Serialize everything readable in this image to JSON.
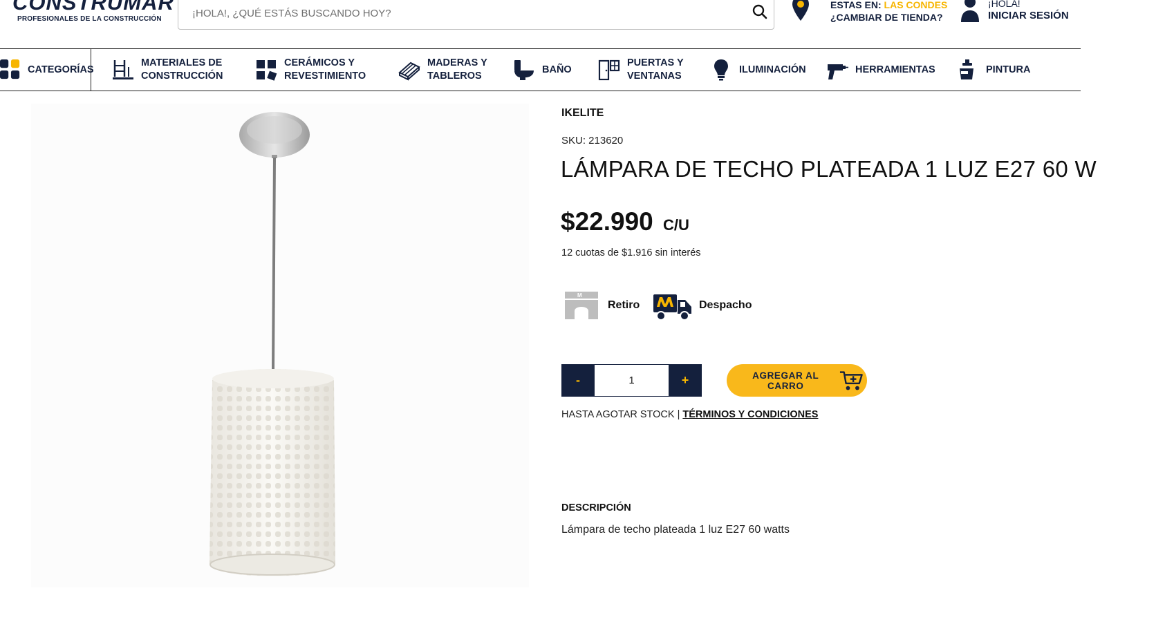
{
  "header": {
    "logo_text_1": "CONSTRU",
    "logo_text_2": "MART",
    "logo_tagline": "PROFESIONALES DE LA CONSTRUCCIÓN",
    "search_placeholder": "¡HOLA!, ¿QUÉ ESTÁS BUSCANDO HOY?",
    "store_prefix": "ESTAS EN:",
    "store_name": "LAS CONDES",
    "store_change": "¿CAMBIAR DE TIENDA?",
    "user_greeting": "¡HOLA!",
    "user_login": "INICIAR SESIÓN"
  },
  "nav": {
    "categories": "CATEGORÍAS",
    "items": [
      {
        "line1": "MATERIALES DE",
        "line2": "CONSTRUCCIÓN"
      },
      {
        "line1": "CERÁMICOS Y",
        "line2": "REVESTIMIENTO"
      },
      {
        "line1": "MADERAS Y",
        "line2": "TABLEROS"
      },
      {
        "line1": "BAÑO",
        "line2": ""
      },
      {
        "line1": "PUERTAS Y",
        "line2": "VENTANAS"
      },
      {
        "line1": "ILUMINACIÓN",
        "line2": ""
      },
      {
        "line1": "HERRAMIENTAS",
        "line2": ""
      },
      {
        "line1": "PINTURA",
        "line2": ""
      }
    ]
  },
  "product": {
    "brand": "IKELITE",
    "sku": "SKU: 213620",
    "title": "LÁMPARA DE TECHO PLATEADA 1 LUZ E27 60 W",
    "price": "$22.990",
    "price_unit": "C/U",
    "installments": "12 cuotas de $1.916 sin interés",
    "option_pickup": "Retiro",
    "option_delivery": "Despacho",
    "qty_minus": "-",
    "qty_value": "1",
    "qty_plus": "+",
    "add_to_cart": "AGREGAR AL CARRO",
    "stock_note": "HASTA AGOTAR STOCK | ",
    "terms_link": "TÉRMINOS Y CONDICIONES",
    "description_heading": "DESCRIPCIÓN",
    "description": "Lámpara de techo plateada 1 luz E27 60 watts"
  },
  "colors": {
    "brand_navy": "#14203d",
    "brand_yellow": "#f7b500"
  }
}
